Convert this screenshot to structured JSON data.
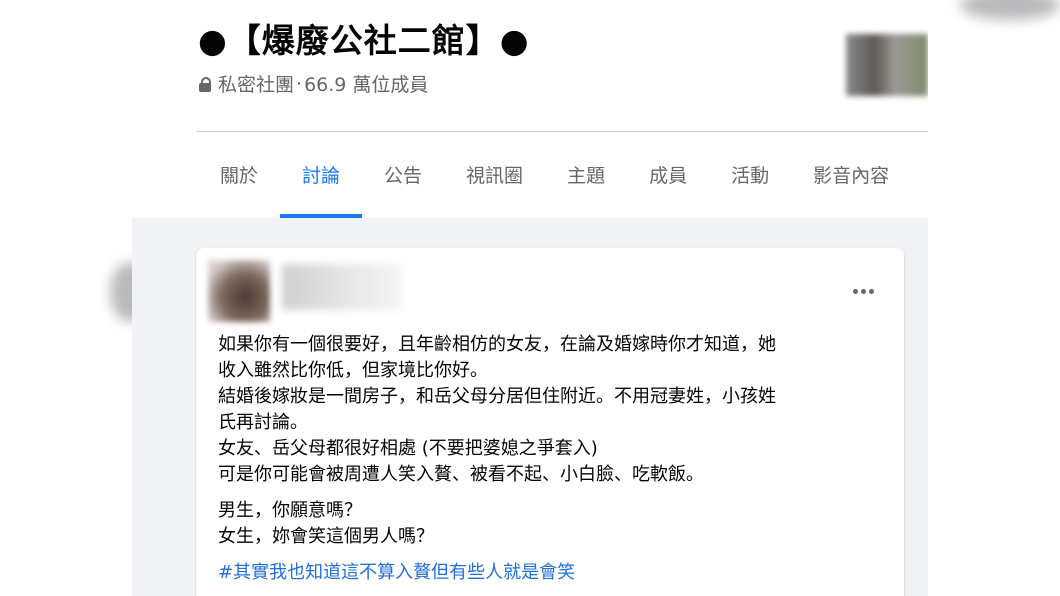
{
  "group": {
    "title": "●【爆廢公社二館】●",
    "privacy": "私密社團",
    "separator": "·",
    "members": "66.9 萬位成員"
  },
  "tabs": [
    {
      "label": "關於",
      "active": false
    },
    {
      "label": "討論",
      "active": true
    },
    {
      "label": "公告",
      "active": false
    },
    {
      "label": "視訊圈",
      "active": false
    },
    {
      "label": "主題",
      "active": false
    },
    {
      "label": "成員",
      "active": false
    },
    {
      "label": "活動",
      "active": false
    },
    {
      "label": "影音內容",
      "active": false
    }
  ],
  "post": {
    "lines": [
      "如果你有一個很要好，且年齡相仿的女友，在論及婚嫁時你才知道，她",
      "收入雖然比你低，但家境比你好。",
      "結婚後嫁妝是一間房子，和岳父母分居但住附近。不用冠妻姓，小孩姓",
      "氏再討論。",
      "女友、岳父母都很好相處 (不要把婆媳之爭套入)",
      "可是你可能會被周遭人笑入贅、被看不起、小白臉、吃軟飯。"
    ],
    "questions": [
      "男生，你願意嗎？",
      "女生，妳會笑這個男人嗎？"
    ],
    "hashtag": "#其實我也知道這不算入贅但有些人就是會笑"
  },
  "colors": {
    "accent": "#1877f2",
    "hashtag": "#216fdb",
    "secondary_text": "#65676b",
    "feed_bg": "#f0f2f5"
  }
}
